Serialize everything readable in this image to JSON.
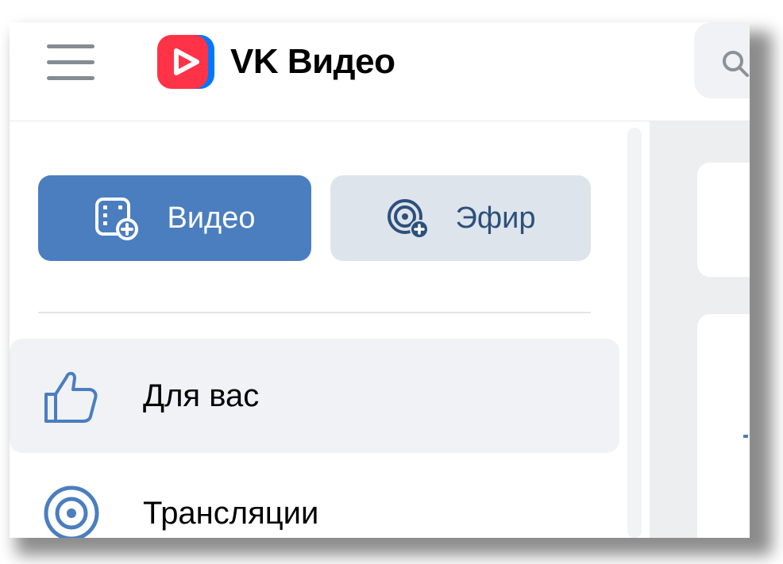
{
  "header": {
    "brand": "VK Видео",
    "logo_icon": "vk-video-play-logo-icon",
    "menu_icon": "hamburger-menu-icon",
    "search_icon": "search-icon"
  },
  "sidebar": {
    "buttons": [
      {
        "label": "Видео",
        "icon": "upload-video-icon",
        "style": "primary"
      },
      {
        "label": "Эфир",
        "icon": "start-stream-icon",
        "style": "secondary"
      }
    ],
    "items": [
      {
        "label": "Для вас",
        "icon": "thumbs-up-icon",
        "active": true
      },
      {
        "label": "Трансляции",
        "icon": "broadcast-icon",
        "active": false
      }
    ]
  },
  "colors": {
    "primary": "#4a7ebf",
    "secondary_bg": "#dde4ec",
    "secondary_text": "#2d507a",
    "active_item_bg": "#f0f2f5",
    "logo_red": "#ff3347",
    "logo_blue": "#0077ff",
    "menu_gray": "#858c94"
  }
}
